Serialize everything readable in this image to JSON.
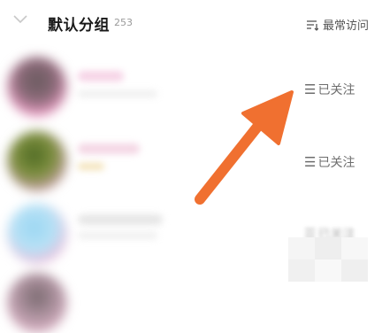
{
  "header": {
    "group_title": "默认分组",
    "count": "253",
    "sort_label": "最常访问"
  },
  "contacts": [
    {
      "follow_label": "已关注",
      "avatar_color": "#d96aa0"
    },
    {
      "follow_label": "已关注",
      "avatar_color": "#6f8a3a"
    },
    {
      "follow_label": "已关注",
      "avatar_color": "#8fd1f0"
    }
  ],
  "icons": {
    "collapse": "chevron-down-icon",
    "sort": "sort-icon",
    "follow": "menu-icon"
  },
  "colors": {
    "accent_arrow": "#f07030"
  }
}
